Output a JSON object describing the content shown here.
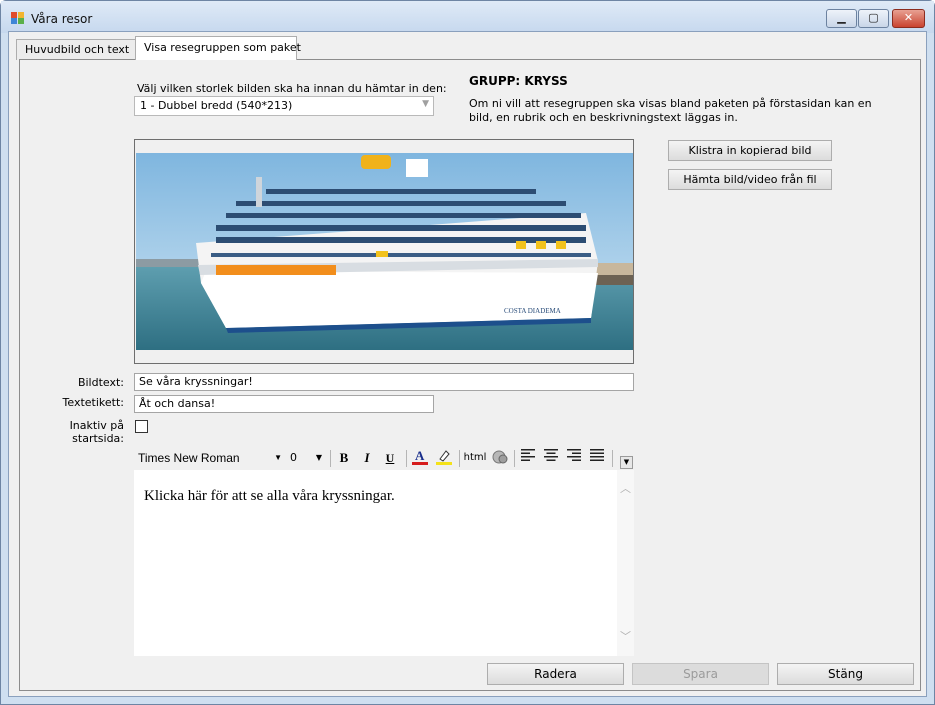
{
  "window": {
    "title": "Våra resor",
    "minimize": "▁",
    "maximize": "▢",
    "close": "✕"
  },
  "tabs": [
    {
      "label": "Huvudbild och text"
    },
    {
      "label": "Visa resegruppen som paket"
    }
  ],
  "image_size": {
    "label": "Välj vilken storlek bilden ska ha innan du hämtar in den:",
    "selected": "1 - Dubbel bredd (540*213)",
    "arrow": "▼"
  },
  "group": {
    "title": "GRUPP: KRYSS",
    "description": "Om ni vill att resegruppen ska visas bland paketen på förstasidan kan en bild, en rubrik och en beskrivningstext läggas in."
  },
  "buttons": {
    "paste": "Klistra in kopierad bild",
    "load": "Hämta bild/video från fil",
    "delete": "Radera",
    "save": "Spara",
    "close": "Stäng"
  },
  "fields": {
    "bildtext": {
      "label": "Bildtext:",
      "value": "Se våra kryssningar!"
    },
    "textetikett": {
      "label": "Textetikett:",
      "value": "Åt och dansa!"
    },
    "inaktiv": {
      "label": "Inaktiv på startsida:",
      "checked": false
    }
  },
  "editor": {
    "font": "Times New Roman",
    "size": "0",
    "bold": "B",
    "italic": "I",
    "underline": "U",
    "html": "html",
    "content": "Klicka här för att se alla våra kryssningar."
  },
  "image": {
    "ship_name": "COSTA DIADEMA"
  }
}
